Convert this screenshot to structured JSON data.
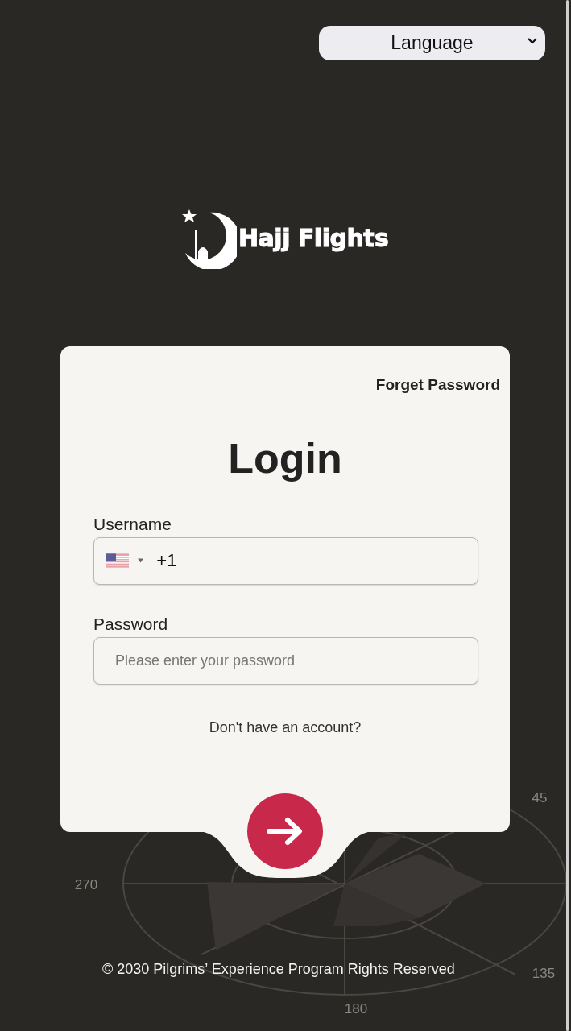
{
  "language_select": {
    "label": "Language"
  },
  "logo": {
    "text": "Hajj Flights"
  },
  "login_card": {
    "forgot_link": "Forget Password",
    "title": "Login",
    "username": {
      "label": "Username",
      "value": "+1"
    },
    "password": {
      "label": "Password",
      "placeholder": "Please enter your password"
    },
    "signup_link": "Don't have an account?"
  },
  "background_diagram": {
    "labels": [
      "45",
      "270",
      "135",
      "180"
    ]
  },
  "footer": "© 2030 Pilgrims’ Experience Program Rights Reserved"
}
